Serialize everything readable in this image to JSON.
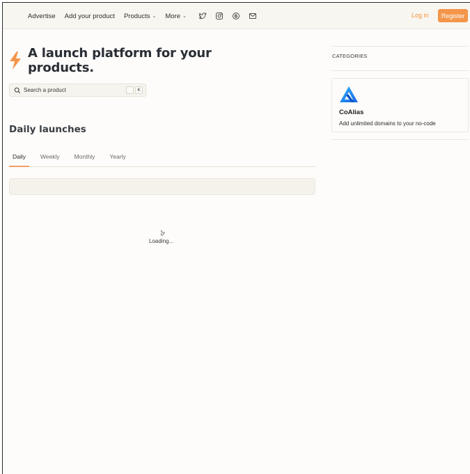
{
  "nav": {
    "links": [
      {
        "label": "Advertise",
        "dropdown": false
      },
      {
        "label": "Add your product",
        "dropdown": false
      },
      {
        "label": "Products",
        "dropdown": true
      },
      {
        "label": "More",
        "dropdown": true
      }
    ],
    "social_icons": [
      "twitter-icon",
      "instagram-icon",
      "threads-icon",
      "mail-icon"
    ],
    "login": "Log in",
    "register": "Register"
  },
  "hero": {
    "title": "A launch platform for your products.",
    "logo_icon": "lightning-bolt-icon"
  },
  "search": {
    "placeholder": "Search a product",
    "shortcut_key": "K"
  },
  "launches": {
    "title": "Daily launches",
    "tabs": [
      "Daily",
      "Weekly",
      "Monthly",
      "Yearly"
    ],
    "active_tab": "Daily",
    "loading_text": "Loading..."
  },
  "sidebar": {
    "categories_label": "CATEGORIES",
    "featured": {
      "name": "CoAlias",
      "description": "Add unlimited domains to your no-code",
      "logo_icon": "coalias-logo-icon"
    }
  },
  "colors": {
    "accent": "#f4954a",
    "background": "#fdfcfa",
    "nav_bg": "#f8f6f1",
    "logo_blue": "#1e8cf0"
  }
}
